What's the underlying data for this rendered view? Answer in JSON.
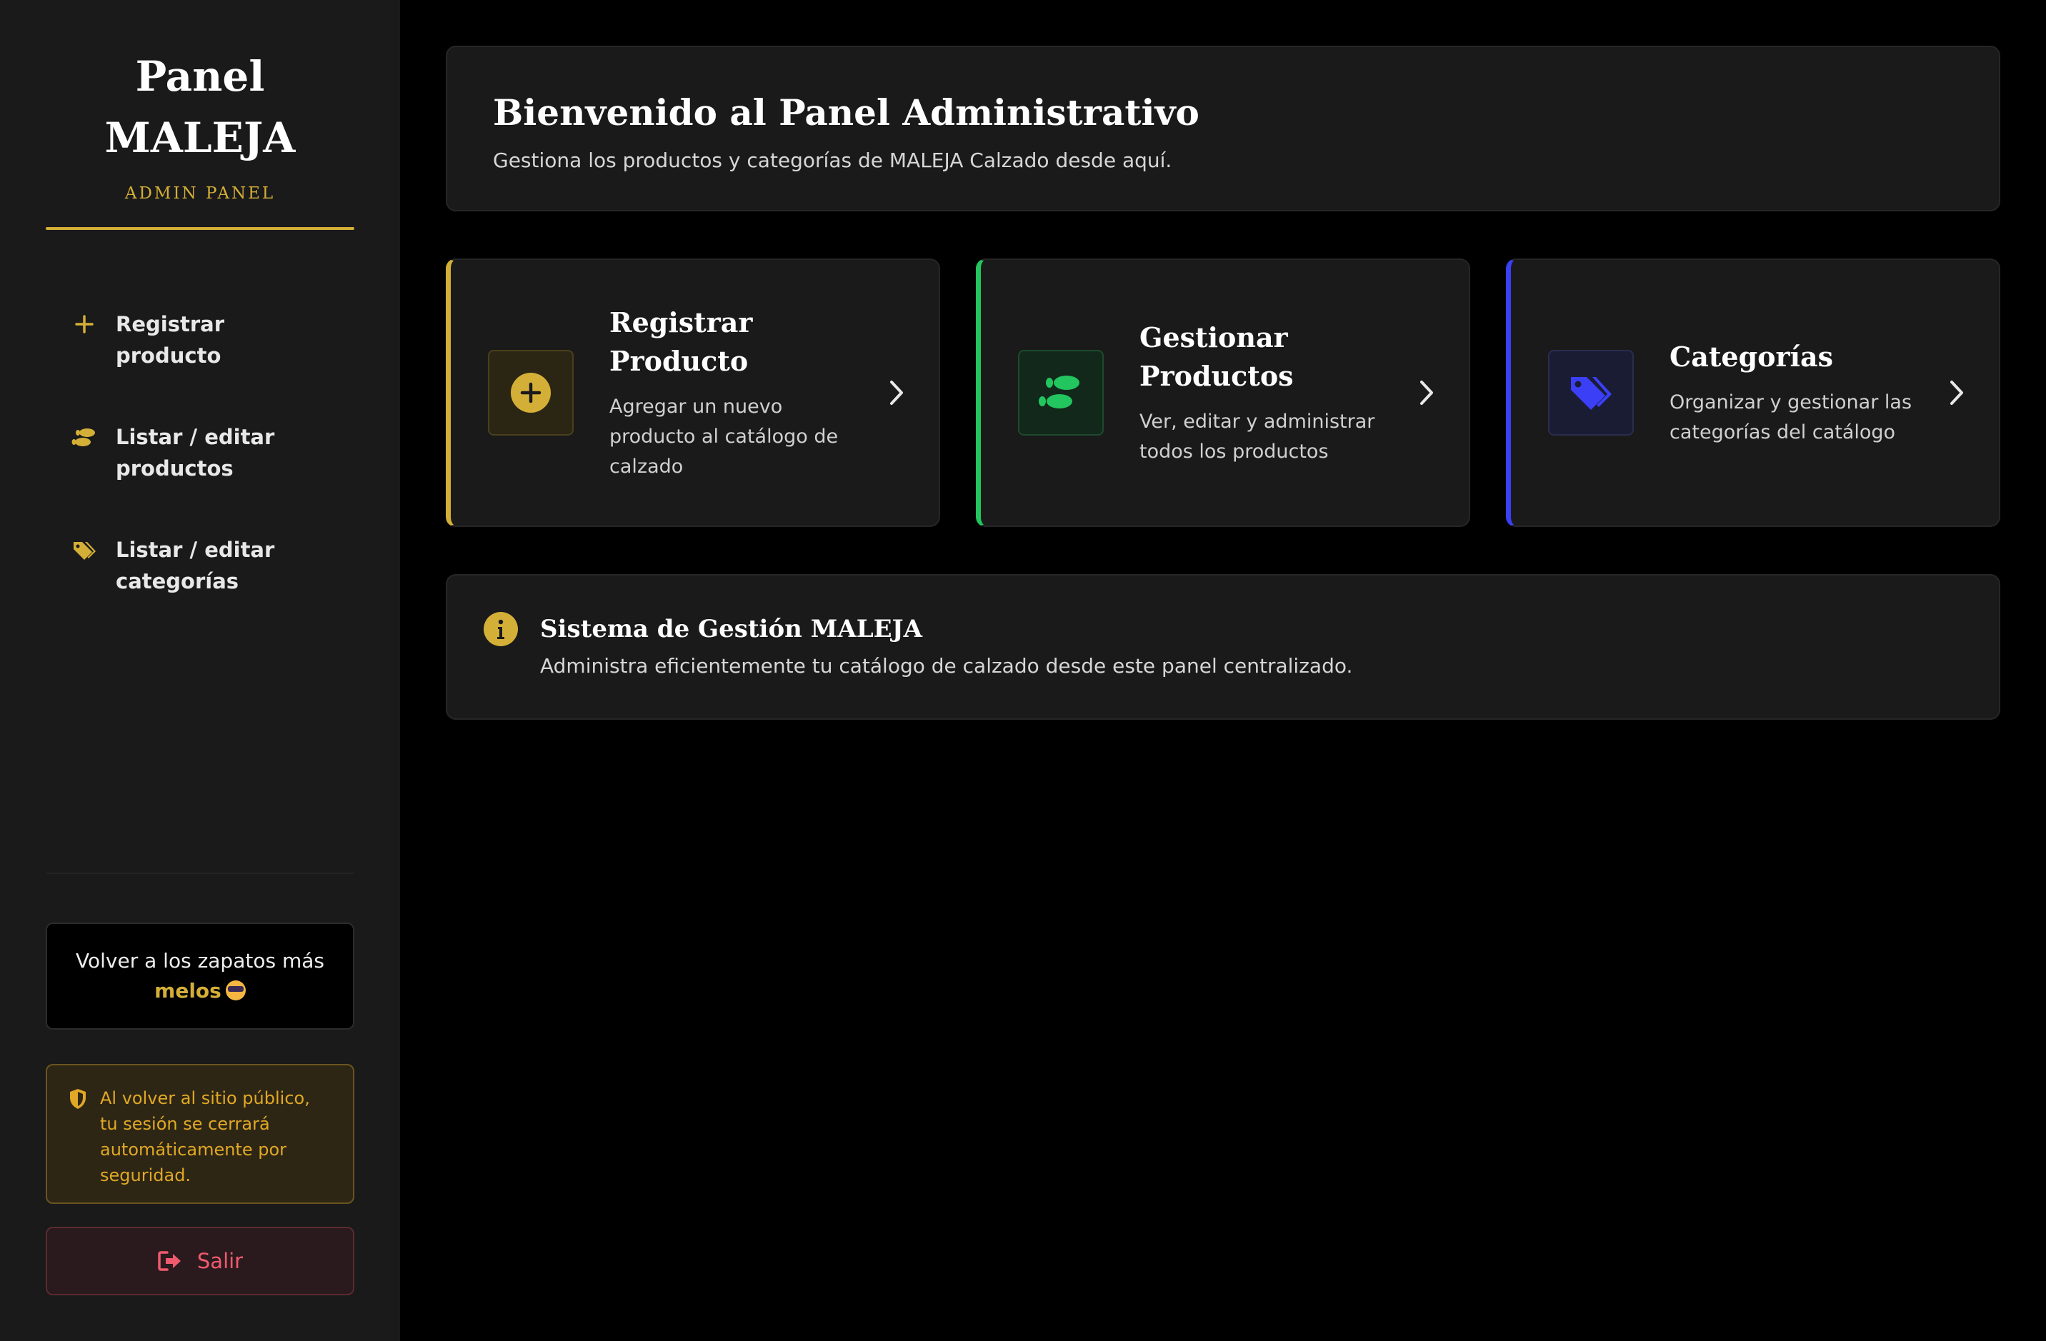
{
  "colors": {
    "gold": "#d4af37",
    "green": "#22c55e",
    "blue": "#3b3ff5",
    "danger": "#f05a6e"
  },
  "sidebar": {
    "brand_line1": "Panel",
    "brand_line2": "MALEJA",
    "brand_sub": "ADMIN PANEL",
    "items": [
      {
        "label": "Registrar producto",
        "icon": "plus-icon"
      },
      {
        "label": "Listar / editar productos",
        "icon": "footprints-icon"
      },
      {
        "label": "Listar / editar categorías",
        "icon": "tags-icon"
      }
    ],
    "back_link": {
      "text": "Volver a los zapatos más",
      "emphasis": "melos",
      "icon": "sunglasses-emoji"
    },
    "notice": {
      "text": "Al volver al sitio público, tu sesión se cerrará automáticamente por seguridad.",
      "icon": "shield-icon"
    },
    "logout": {
      "label": "Salir",
      "icon": "logout-icon"
    }
  },
  "main": {
    "welcome": {
      "title": "Bienvenido al Panel Administrativo",
      "subtitle": "Gestiona los productos y categorías de MALEJA Calzado desde aquí."
    },
    "cards": [
      {
        "title": "Registrar Producto",
        "description": "Agregar un nuevo producto al catálogo de calzado",
        "icon": "plus-circle-icon"
      },
      {
        "title": "Gestionar Productos",
        "description": "Ver, editar y administrar todos los productos",
        "icon": "footprints-icon"
      },
      {
        "title": "Categorías",
        "description": "Organizar y gestionar las categorías del catálogo",
        "icon": "tags-icon"
      }
    ],
    "info": {
      "title": "Sistema de Gestión MALEJA",
      "text": "Administra eficientemente tu catálogo de calzado desde este panel centralizado.",
      "icon": "info-icon"
    }
  }
}
